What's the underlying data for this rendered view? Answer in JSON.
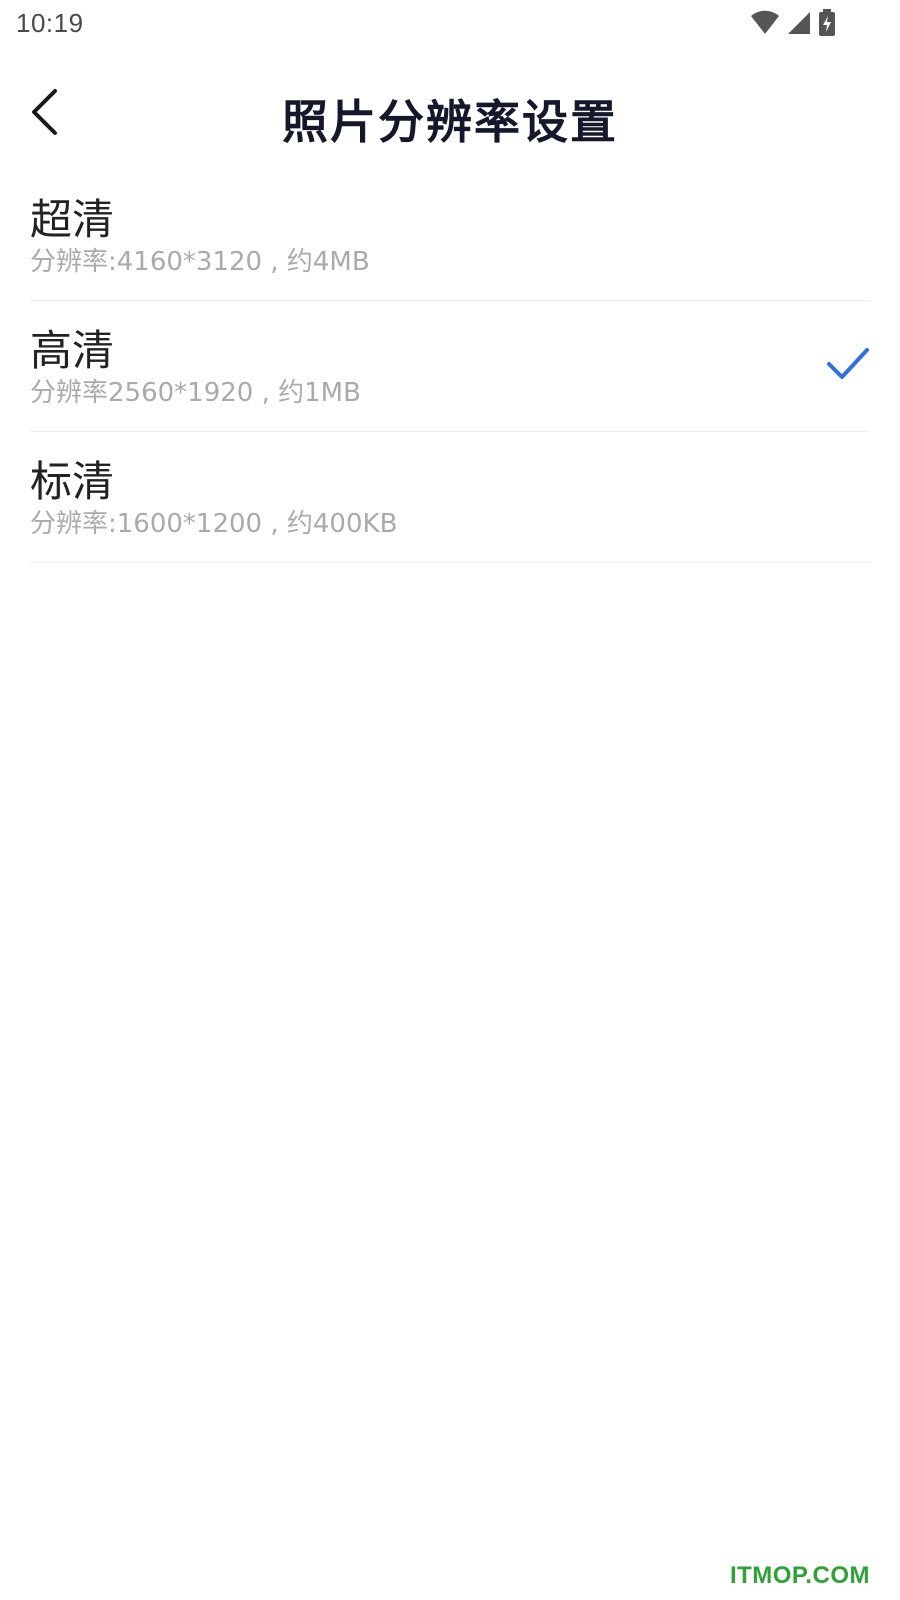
{
  "status_bar": {
    "time": "10:19",
    "icons": [
      "wifi-icon",
      "cellular-signal-icon",
      "battery-charging-icon"
    ]
  },
  "header": {
    "back_icon": "chevron-left-icon",
    "title": "照片分辨率设置"
  },
  "options": [
    {
      "title": "超清",
      "subtitle": "分辨率:4160*3120 , 约4MB",
      "selected": false
    },
    {
      "title": "高清",
      "subtitle": "分辨率2560*1920 , 约1MB",
      "selected": true
    },
    {
      "title": "标清",
      "subtitle": "分辨率:1600*1200 , 约400KB",
      "selected": false
    }
  ],
  "colors": {
    "accent": "#2f6fe0",
    "title_text": "#14182a",
    "subtitle_text": "#aaaaaa",
    "watermark": "#2ea236"
  },
  "watermark": "ITMOP.COM"
}
